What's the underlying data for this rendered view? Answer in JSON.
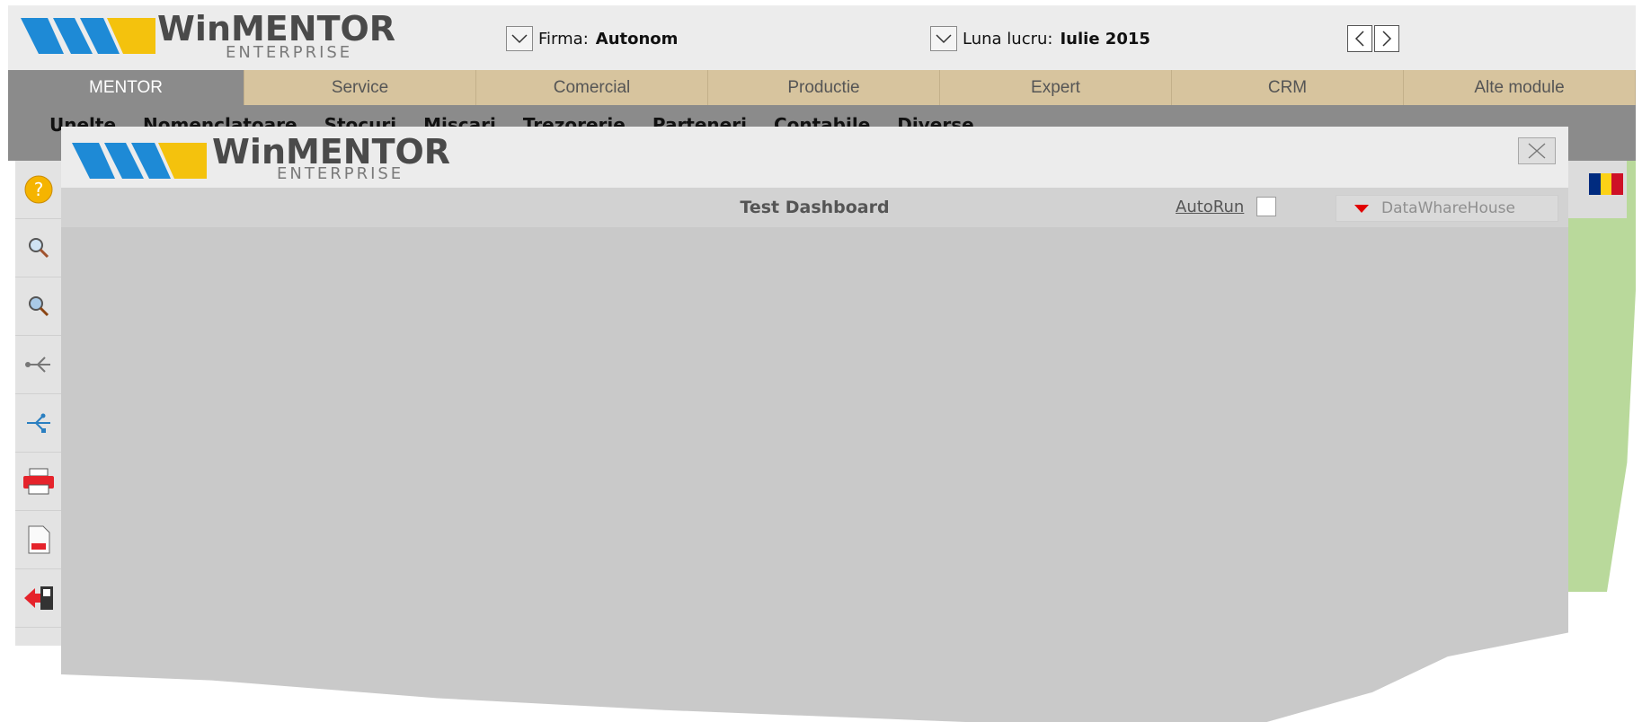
{
  "app": {
    "logo_word": "WinMENTOR",
    "logo_sub": "ENTERPRISE"
  },
  "header": {
    "firma_label": "Firma:",
    "firma_value": "Autonom",
    "luna_label": "Luna lucru:",
    "luna_value": "Iulie 2015"
  },
  "tabs": [
    {
      "label": "MENTOR"
    },
    {
      "label": "Service"
    },
    {
      "label": "Comercial"
    },
    {
      "label": "Productie"
    },
    {
      "label": "Expert"
    },
    {
      "label": "CRM"
    },
    {
      "label": "Alte module"
    }
  ],
  "submenu": [
    {
      "label": "Unelte"
    },
    {
      "label": "Nomenclatoare"
    },
    {
      "label": "Stocuri"
    },
    {
      "label": "Miscari"
    },
    {
      "label": "Trezorerie"
    },
    {
      "label": "Parteneri"
    },
    {
      "label": "Contabile"
    },
    {
      "label": "Diverse"
    }
  ],
  "toolbar_icons": [
    "help-icon",
    "search-icon",
    "search-advanced-icon",
    "usb-disconnect-icon",
    "usb-icon",
    "printer-icon",
    "report-icon",
    "exit-icon"
  ],
  "dialog": {
    "logo_word": "WinMENTOR",
    "logo_sub": "ENTERPRISE",
    "title": "Test Dashboard",
    "autorun_label": "AutoRun",
    "autorun_checked": false,
    "source_selected": "DataWhareHouse"
  },
  "colors": {
    "accent_tab_active": "#8b8b8b",
    "tab_bg": "#d7c49e",
    "logo_blue": "#1e8ad6",
    "logo_yellow": "#f4c20d",
    "dropdown_arrow": "#e10000"
  }
}
